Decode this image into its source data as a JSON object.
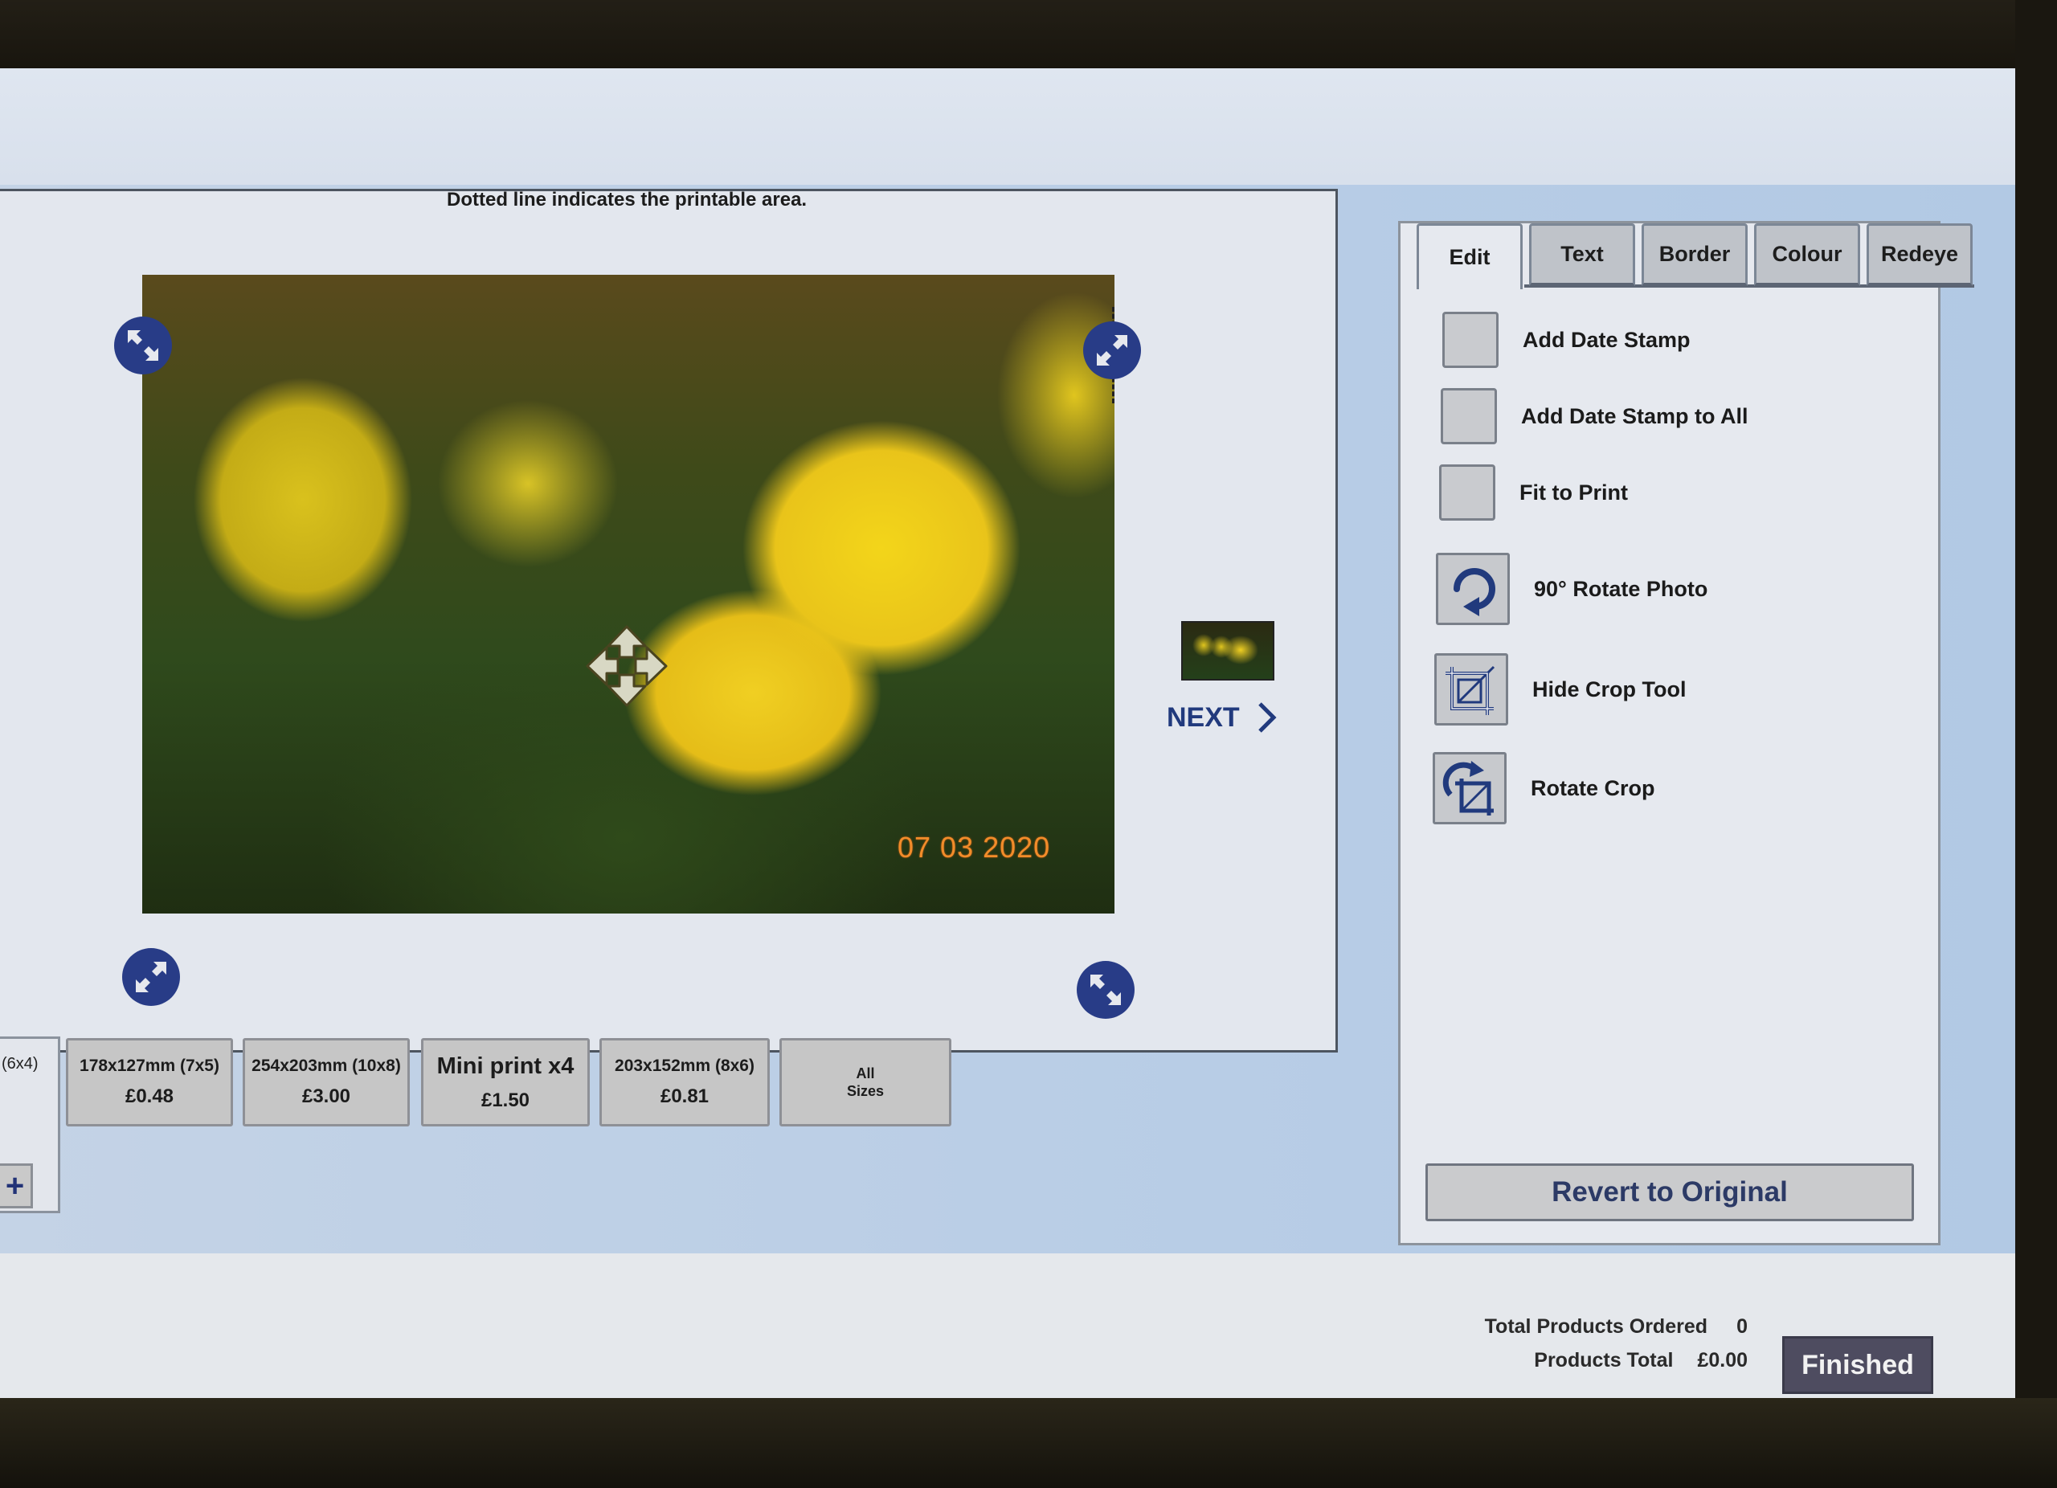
{
  "editor": {
    "printable_note": "Dotted line indicates the printable area.",
    "photo": {
      "subject": "yellow daffodils",
      "date_stamp": "07 03 2020"
    },
    "next_label": "NEXT"
  },
  "sizes": {
    "partial_left_label": "(6x4)",
    "add_symbol": "+",
    "items": [
      {
        "name": "178x127mm (7x5)",
        "price": "£0.48"
      },
      {
        "name": "254x203mm (10x8)",
        "price": "£3.00"
      },
      {
        "name": "Mini print x4",
        "price": "£1.50"
      },
      {
        "name": "203x152mm (8x6)",
        "price": "£0.81"
      },
      {
        "name": "All Sizes",
        "price": ""
      }
    ]
  },
  "side_panel": {
    "tabs": [
      {
        "label": "Edit",
        "active": true
      },
      {
        "label": "Text",
        "active": false
      },
      {
        "label": "Border",
        "active": false
      },
      {
        "label": "Colour",
        "active": false
      },
      {
        "label": "Redeye",
        "active": false
      }
    ],
    "checkboxes": [
      {
        "label": "Add Date Stamp",
        "checked": false
      },
      {
        "label": "Add Date Stamp to All",
        "checked": false
      },
      {
        "label": "Fit to Print",
        "checked": false
      }
    ],
    "tools": [
      {
        "label": "90° Rotate Photo",
        "icon": "rotate-icon"
      },
      {
        "label": "Hide Crop Tool",
        "icon": "crop-icon"
      },
      {
        "label": "Rotate Crop",
        "icon": "rotate-crop-icon"
      }
    ],
    "revert_label": "Revert to Original"
  },
  "footer": {
    "total_products_ordered_label": "Total Products Ordered",
    "total_products_ordered_value": "0",
    "products_total_label": "Products Total",
    "products_total_value": "£0.00",
    "finished_label": "Finished"
  },
  "colors": {
    "accent_blue": "#283c87",
    "finished_button": "#4e4c60",
    "date_stamp": "#f28c2a"
  }
}
